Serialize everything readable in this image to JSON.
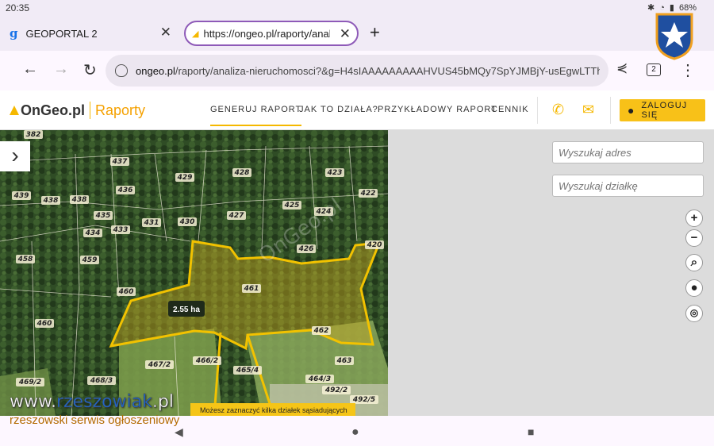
{
  "status": {
    "time": "20:35",
    "battery": "68%"
  },
  "tabs": [
    {
      "favicon": "g",
      "title": "GEOPORTAL 2"
    },
    {
      "title": "https://ongeo.pl/raporty/analiza"
    }
  ],
  "address_bar": {
    "url_prefix": "ongeo.pl",
    "url_rest": "/raporty/analiza-nieruchomosci?&g=H4sIAAAAAAAAAHVUS45bMQy7SpYJMBjY-usEgwLTThfto",
    "tab_count": "2"
  },
  "site": {
    "logo_brand": "OnGeo.pl",
    "logo_sub": "Raporty",
    "menu": [
      "GENERUJ RAPORT",
      "JAK TO DZIAŁA?",
      "PRZYKŁADOWY RAPORT",
      "CENNIK"
    ],
    "login_label": "ZALOGUJ SIĘ"
  },
  "map": {
    "area_label": "2.55 ha",
    "hint": "Możesz zaznaczyć kilka działek sąsiadujących",
    "parcels": [
      "382",
      "437",
      "429",
      "428",
      "423",
      "436",
      "422",
      "439",
      "438",
      "438",
      "435",
      "431",
      "430",
      "427",
      "425",
      "424",
      "434",
      "433",
      "426",
      "420",
      "458",
      "459",
      "461",
      "460",
      "462",
      "460",
      "467/2",
      "466/2",
      "465/4",
      "463",
      "464/3",
      "468/3",
      "469/2",
      "492/2",
      "492/5"
    ],
    "watermark": "OnGeo.pl",
    "selected_color": "#f2c200"
  },
  "controls": {
    "search_address_placeholder": "Wyszukaj adres",
    "search_parcel_placeholder": "Wyszukaj działkę"
  },
  "overlay": {
    "brand_main": "www.",
    "brand_accent": "rzeszowiak",
    "brand_tld": ".pl",
    "brand_sub": "rzeszowski serwis ogłoszeniowy"
  }
}
